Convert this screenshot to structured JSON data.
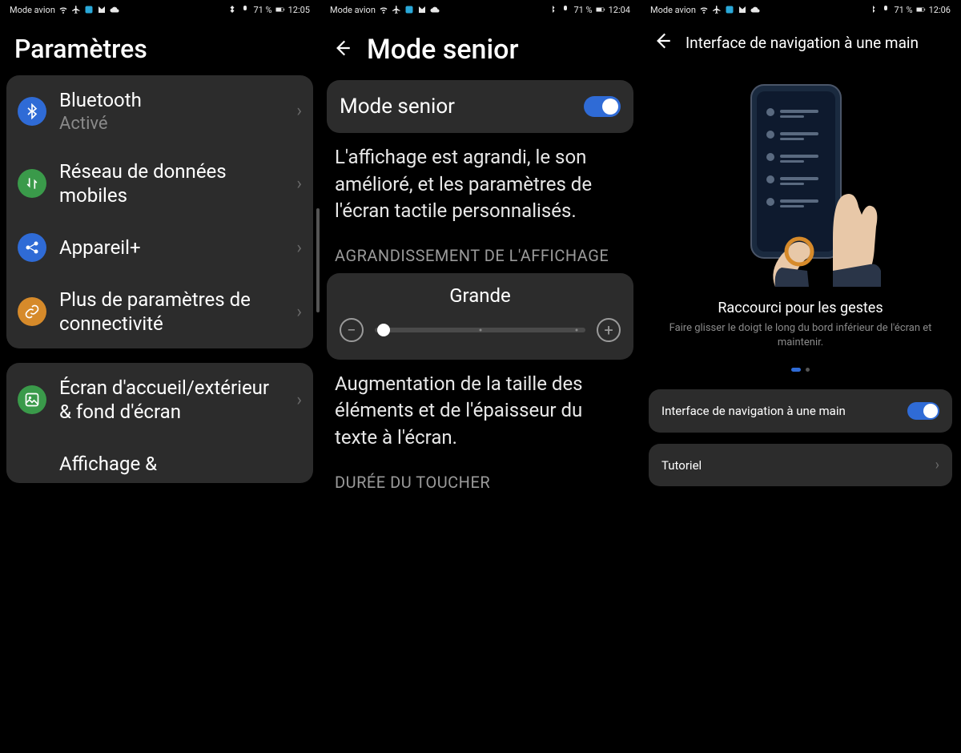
{
  "status": {
    "label": "Mode avion",
    "battery": "71 %",
    "t1": "12:05",
    "t2": "12:04",
    "t3": "12:06"
  },
  "panel1": {
    "title": "Paramètres",
    "items": [
      {
        "label": "Bluetooth",
        "sub": "Activé",
        "icon": "bluetooth",
        "color": "#2f6bd6"
      },
      {
        "label": "Réseau de données mobiles",
        "icon": "data",
        "color": "#3a9a4a"
      },
      {
        "label": "Appareil+",
        "icon": "share",
        "color": "#2f6bd6"
      },
      {
        "label": "Plus de paramètres de connectivité",
        "icon": "link",
        "color": "#d68a2a"
      }
    ],
    "group2": [
      {
        "label": "Écran d'accueil/extérieur & fond d'écran",
        "icon": "image",
        "color": "#3a9a4a"
      },
      {
        "label": "Affichage &",
        "icon": "display",
        "color": "#2f6bd6"
      }
    ]
  },
  "panel2": {
    "title": "Mode senior",
    "toggle_label": "Mode senior",
    "desc": "L'affichage est agrandi, le son amélioré, et les paramètres de l'écran tactile personnalisés.",
    "section1": "AGRANDISSEMENT DE L'AFFICHAGE",
    "slider_label": "Grande",
    "desc2": "Augmentation de la taille des éléments et de l'épaisseur du texte à l'écran.",
    "section2": "DURÉE DU TOUCHER"
  },
  "panel3": {
    "title": "Interface de navigation à une main",
    "heading": "Raccourci pour les gestes",
    "sub": "Faire glisser le doigt le long du bord inférieur de l'écran et maintenir.",
    "row1_label": "Interface de navigation à une main",
    "row2_label": "Tutoriel"
  }
}
